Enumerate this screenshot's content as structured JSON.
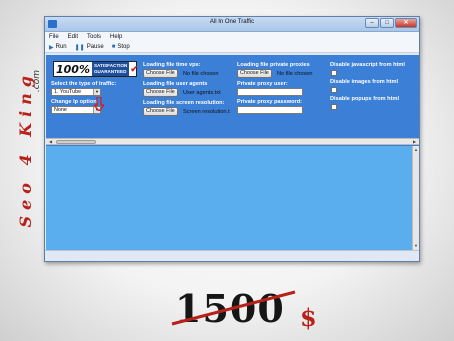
{
  "side_brand": {
    "text": "Seo 4 King",
    "suffix": ".com"
  },
  "window": {
    "title": "All In One Traffic",
    "controls": {
      "minimize": "–",
      "maximize": "□",
      "close": "✕"
    }
  },
  "menu": [
    "File",
    "Edit",
    "Tools",
    "Help"
  ],
  "toolbar": [
    {
      "icon": "play-icon",
      "glyph": "▶",
      "label": "Run"
    },
    {
      "icon": "pause-icon",
      "glyph": "❚❚",
      "label": "Pause"
    },
    {
      "icon": "stop-icon",
      "glyph": "■",
      "label": "Stop"
    }
  ],
  "panel": {
    "badge": {
      "pct": "100%",
      "line1": "SATISFACTION",
      "line2": "GUARANTEED",
      "check": "✔"
    },
    "traffic_type": {
      "label": "Select the type of traffic:",
      "value": "1. YouTube"
    },
    "ip_option": {
      "label": "Change Ip option",
      "value": "None"
    },
    "files": [
      {
        "label": "Loading file time vps:",
        "button": "Choose File",
        "status": "No file chosen"
      },
      {
        "label": "Loading file user agents",
        "button": "Choose File",
        "status": "User agents.txt"
      },
      {
        "label": "Loading file screen resolution:",
        "button": "Choose File",
        "status": "Screen resolution.t"
      }
    ],
    "proxy": {
      "file": {
        "label": "Loading file private proxies",
        "button": "Choose File",
        "status": "No file chosen"
      },
      "user_label": "Private proxy user:",
      "password_label": "Private proxy password:"
    },
    "disable": [
      {
        "label": "Disable javascript from html"
      },
      {
        "label": "Disable images from html"
      },
      {
        "label": "Disable popups from html"
      }
    ]
  },
  "price": {
    "old": "1500",
    "currency": "$"
  },
  "colors": {
    "panel": "#3b7fd6",
    "browser": "#5aaeee",
    "accent_red": "#b8211a"
  }
}
